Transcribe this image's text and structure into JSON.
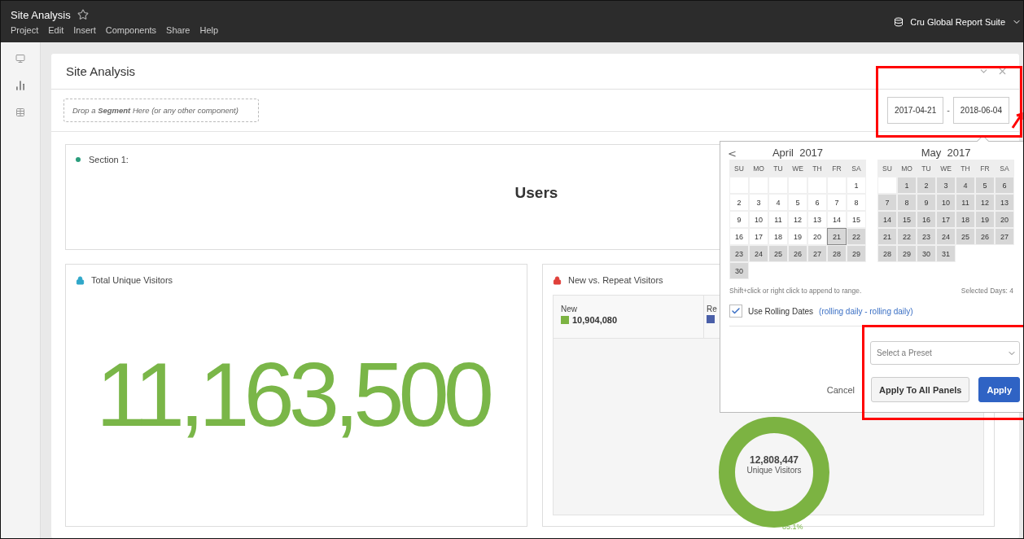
{
  "app_bar": {
    "title": "Site Analysis",
    "favorite": false,
    "menu": [
      "Project",
      "Edit",
      "Insert",
      "Components",
      "Share",
      "Help"
    ],
    "report_suite": "Cru Global Report Suite"
  },
  "panel": {
    "title": "Site Analysis",
    "segment_drop": "Drop a **Segment** Here *(or any other component)*",
    "date_start": "2017-04-21",
    "date_separator": "-",
    "date_end": "2018-06-04"
  },
  "section": {
    "label": "Section 1:",
    "heading": "Users"
  },
  "cards": [
    {
      "kind": "number",
      "title": "Total Unique Visitors",
      "color": "#2fa7c9",
      "value": "11,163,500"
    },
    {
      "kind": "donut",
      "title": "New vs. Repeat Visitors",
      "color": "#e0403a",
      "legend": [
        {
          "label": "New",
          "value": "10,904,080",
          "color": "#7cb342"
        },
        {
          "label": "Re",
          "color": "#4a5fa8"
        }
      ],
      "center_value": "12,808,447",
      "center_label": "Unique Visitors",
      "share_label": "85.1%"
    }
  ],
  "date_picker": {
    "prev": "<",
    "months": [
      {
        "name": "April",
        "year": "2017",
        "weekdays": [
          "SU",
          "MO",
          "TU",
          "WE",
          "TH",
          "FR",
          "SA"
        ],
        "weeks": [
          [
            {
              "kind": "blank"
            },
            {
              "kind": "blank"
            },
            {
              "kind": "blank"
            },
            {
              "kind": "blank"
            },
            {
              "kind": "blank"
            },
            {
              "kind": "blank"
            },
            {
              "kind": "day",
              "d": "1",
              "selected": false,
              "focused": false
            }
          ],
          [
            {
              "kind": "day",
              "d": "2",
              "selected": false,
              "focused": false
            },
            {
              "kind": "day",
              "d": "3",
              "selected": false,
              "focused": false
            },
            {
              "kind": "day",
              "d": "4",
              "selected": false,
              "focused": false
            },
            {
              "kind": "day",
              "d": "5",
              "selected": false,
              "focused": false
            },
            {
              "kind": "day",
              "d": "6",
              "selected": false,
              "focused": false
            },
            {
              "kind": "day",
              "d": "7",
              "selected": false,
              "focused": false
            },
            {
              "kind": "day",
              "d": "8",
              "selected": false,
              "focused": false
            }
          ],
          [
            {
              "kind": "day",
              "d": "9",
              "selected": false,
              "focused": false
            },
            {
              "kind": "day",
              "d": "10",
              "selected": false,
              "focused": false
            },
            {
              "kind": "day",
              "d": "11",
              "selected": false,
              "focused": false
            },
            {
              "kind": "day",
              "d": "12",
              "selected": false,
              "focused": false
            },
            {
              "kind": "day",
              "d": "13",
              "selected": false,
              "focused": false
            },
            {
              "kind": "day",
              "d": "14",
              "selected": false,
              "focused": false
            },
            {
              "kind": "day",
              "d": "15",
              "selected": false,
              "focused": false
            }
          ],
          [
            {
              "kind": "day",
              "d": "16",
              "selected": false,
              "focused": false
            },
            {
              "kind": "day",
              "d": "17",
              "selected": false,
              "focused": false
            },
            {
              "kind": "day",
              "d": "18",
              "selected": false,
              "focused": false
            },
            {
              "kind": "day",
              "d": "19",
              "selected": false,
              "focused": false
            },
            {
              "kind": "day",
              "d": "20",
              "selected": false,
              "focused": false
            },
            {
              "kind": "day",
              "d": "21",
              "selected": true,
              "focused": true
            },
            {
              "kind": "day",
              "d": "22",
              "selected": true,
              "focused": false
            }
          ],
          [
            {
              "kind": "day",
              "d": "23",
              "selected": true,
              "focused": false
            },
            {
              "kind": "day",
              "d": "24",
              "selected": true,
              "focused": false
            },
            {
              "kind": "day",
              "d": "25",
              "selected": true,
              "focused": false
            },
            {
              "kind": "day",
              "d": "26",
              "selected": true,
              "focused": false
            },
            {
              "kind": "day",
              "d": "27",
              "selected": true,
              "focused": false
            },
            {
              "kind": "day",
              "d": "28",
              "selected": true,
              "focused": false
            },
            {
              "kind": "day",
              "d": "29",
              "selected": true,
              "focused": false
            }
          ],
          [
            {
              "kind": "day",
              "d": "30",
              "selected": true,
              "focused": false
            }
          ]
        ]
      },
      {
        "name": "May",
        "year": "2017",
        "weekdays": [
          "SU",
          "MO",
          "TU",
          "WE",
          "TH",
          "FR",
          "SA"
        ],
        "weeks": [
          [
            {
              "kind": "blank"
            },
            {
              "kind": "day",
              "d": "1",
              "selected": true,
              "focused": false
            },
            {
              "kind": "day",
              "d": "2",
              "selected": true,
              "focused": false
            },
            {
              "kind": "day",
              "d": "3",
              "selected": true,
              "focused": false
            },
            {
              "kind": "day",
              "d": "4",
              "selected": true,
              "focused": false
            },
            {
              "kind": "day",
              "d": "5",
              "selected": true,
              "focused": false
            },
            {
              "kind": "day",
              "d": "6",
              "selected": true,
              "focused": false
            }
          ],
          [
            {
              "kind": "day",
              "d": "7",
              "selected": true,
              "focused": false
            },
            {
              "kind": "day",
              "d": "8",
              "selected": true,
              "focused": false
            },
            {
              "kind": "day",
              "d": "9",
              "selected": true,
              "focused": false
            },
            {
              "kind": "day",
              "d": "10",
              "selected": true,
              "focused": false
            },
            {
              "kind": "day",
              "d": "11",
              "selected": true,
              "focused": false
            },
            {
              "kind": "day",
              "d": "12",
              "selected": true,
              "focused": false
            },
            {
              "kind": "day",
              "d": "13",
              "selected": true,
              "focused": false
            }
          ],
          [
            {
              "kind": "day",
              "d": "14",
              "selected": true,
              "focused": false
            },
            {
              "kind": "day",
              "d": "15",
              "selected": true,
              "focused": false
            },
            {
              "kind": "day",
              "d": "16",
              "selected": true,
              "focused": false
            },
            {
              "kind": "day",
              "d": "17",
              "selected": true,
              "focused": false
            },
            {
              "kind": "day",
              "d": "18",
              "selected": true,
              "focused": false
            },
            {
              "kind": "day",
              "d": "19",
              "selected": true,
              "focused": false
            },
            {
              "kind": "day",
              "d": "20",
              "selected": true,
              "focused": false
            }
          ],
          [
            {
              "kind": "day",
              "d": "21",
              "selected": true,
              "focused": false
            },
            {
              "kind": "day",
              "d": "22",
              "selected": true,
              "focused": false
            },
            {
              "kind": "day",
              "d": "23",
              "selected": true,
              "focused": false
            },
            {
              "kind": "day",
              "d": "24",
              "selected": true,
              "focused": false
            },
            {
              "kind": "day",
              "d": "25",
              "selected": true,
              "focused": false
            },
            {
              "kind": "day",
              "d": "26",
              "selected": true,
              "focused": false
            },
            {
              "kind": "day",
              "d": "27",
              "selected": true,
              "focused": false
            }
          ],
          [
            {
              "kind": "day",
              "d": "28",
              "selected": true,
              "focused": false
            },
            {
              "kind": "day",
              "d": "29",
              "selected": true,
              "focused": false
            },
            {
              "kind": "day",
              "d": "30",
              "selected": true,
              "focused": false
            },
            {
              "kind": "day",
              "d": "31",
              "selected": true,
              "focused": false
            }
          ]
        ]
      }
    ],
    "hint": "Shift+click or right click to append to range.",
    "selected_days": "Selected Days: 4",
    "rolling": {
      "label": "Use Rolling Dates",
      "checked": true,
      "detail": "(rolling daily - rolling daily)"
    },
    "preset": {
      "placeholder": "Select a Preset"
    },
    "buttons": [
      {
        "kind": "plain",
        "label": "Cancel"
      },
      {
        "kind": "secondary",
        "label": "Apply To All Panels"
      },
      {
        "kind": "primary",
        "label": "Apply"
      }
    ]
  }
}
